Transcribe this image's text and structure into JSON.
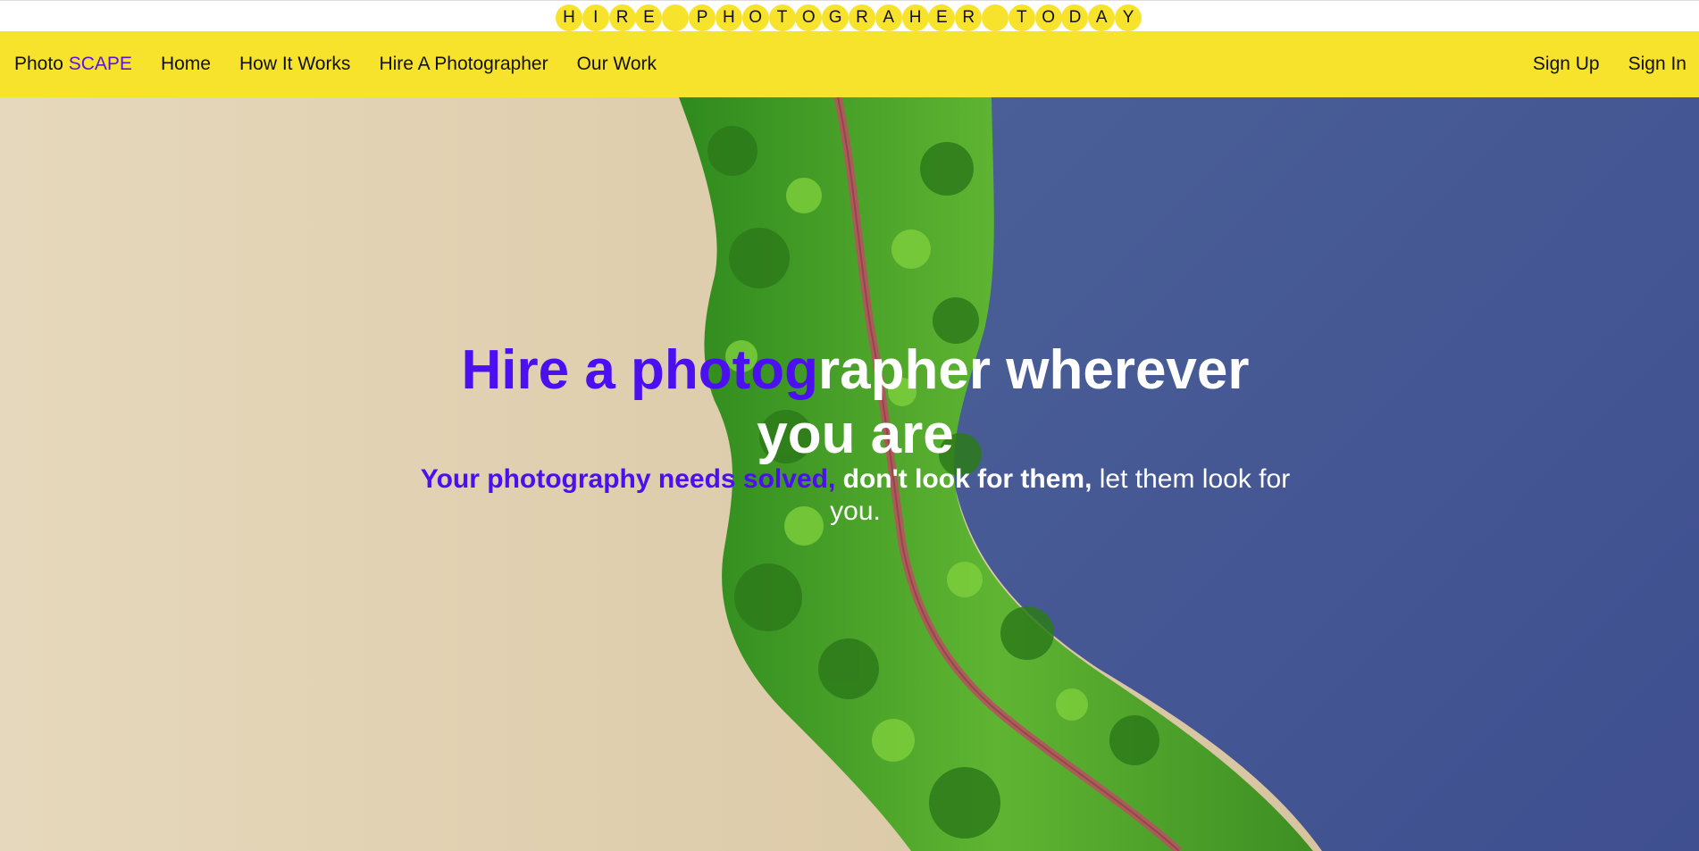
{
  "banner": {
    "letters": [
      "H",
      "I",
      "R",
      "E",
      " ",
      "P",
      "H",
      "O",
      "T",
      "O",
      "G",
      "R",
      "A",
      "H",
      "E",
      "R",
      " ",
      "T",
      "O",
      "D",
      "A",
      "Y"
    ]
  },
  "nav": {
    "brand_prefix": "Photo",
    "brand_accent": "SCAPE",
    "links": [
      "Home",
      "How It Works",
      "Hire A Photographer",
      "Our Work"
    ],
    "sign_up": "Sign Up",
    "sign_in": "Sign In"
  },
  "hero": {
    "headline_purple": "Hire a photog",
    "headline_white": "rapher wherever you are",
    "sub_purple": "Your photography needs solved,",
    "sub_bold": " don't look for them,",
    "sub_rest": " let them look for you."
  },
  "colors": {
    "accent_yellow": "#f8e32c",
    "brand_purple": "#4c0ff0",
    "water_blue": "#4a5f97",
    "sand": "#dcc8a5",
    "foliage_green": "#4fa52b"
  },
  "icons": {
    "hero_image": "aerial-river-path-image"
  }
}
